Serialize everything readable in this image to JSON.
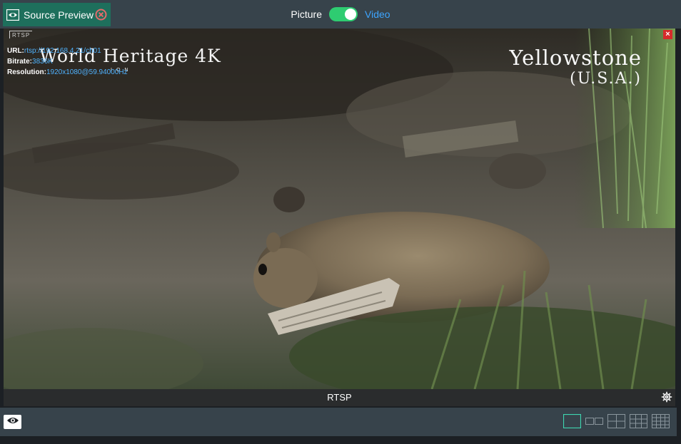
{
  "header": {
    "tab_label": "Source Preview",
    "mode_left": "Picture",
    "mode_right": "Video",
    "toggle_on": true
  },
  "viewer": {
    "source_tag": "RTSP",
    "info": {
      "url_label": "URL:",
      "url_value": "rtsp://192.168.4.21/ch01",
      "bitrate_label": "Bitrate:",
      "bitrate_value": "3836K",
      "resolution_label": "Resolution:",
      "resolution_value": "1920x1080@59.94000Hz"
    },
    "overlay_left_title": "World Heritage 4K",
    "overlay_left_sub": "ION",
    "overlay_right_title": "Yellowstone",
    "overlay_right_sub": "(U.S.A.)",
    "caption": "RTSP"
  },
  "footer": {
    "active_layout": 0
  },
  "colors": {
    "accent": "#1e6f5c",
    "toggle": "#2ecc71",
    "link": "#3da5ff",
    "bar": "#37434b",
    "layout_active": "#3ed6b0"
  }
}
